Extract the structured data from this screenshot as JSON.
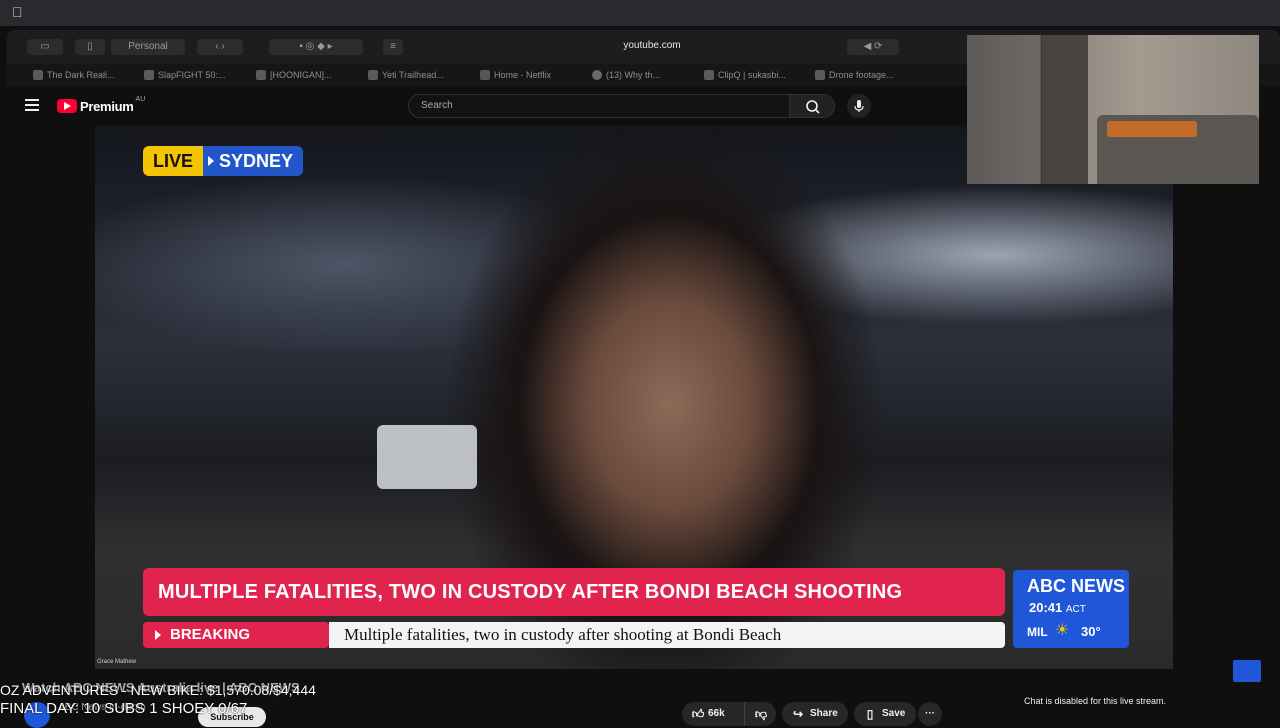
{
  "os": {
    "apple_icon": "apple-icon"
  },
  "browser": {
    "url": "youtube.com",
    "profile_label": "Personal",
    "tabs": [
      {
        "title": "The Dark Reali..."
      },
      {
        "title": "SlapFIGHT 50:..."
      },
      {
        "title": "[HOONIGAN]..."
      },
      {
        "title": "Yeti Trailhead..."
      },
      {
        "title": "Home - Netflix"
      },
      {
        "title": "(13) Why th..."
      },
      {
        "title": "ClipQ | sukasbi..."
      },
      {
        "title": "Drone footage..."
      }
    ]
  },
  "youtube": {
    "logo_text": "Premium",
    "region": "AU",
    "search_placeholder": "Search"
  },
  "video": {
    "live_word": "LIVE",
    "live_city": "SYDNEY",
    "headline": "MULTIPLE FATALITIES, TWO IN CUSTODY AFTER BONDI BEACH SHOOTING",
    "breaking_label": "BREAKING",
    "ticker": "Multiple fatalities, two in custody after shooting at Bondi Beach",
    "network": "ABC NEWS",
    "time": "20:41",
    "timezone": "ACT",
    "weather_location": "MIL",
    "temperature": "30°",
    "reporter": "Grace Mathew"
  },
  "overlay": {
    "line1": "OZ ADVENTURES - NEW BIKE: $1,570.08/$4,444",
    "line2": "FINAL DAY: 10 SUBS 1 SHOEY 0/67"
  },
  "below_video": {
    "title": "Watch ABC NEWS Australia live | ABC NEWS",
    "channel": "ABC News In-depth",
    "subscribe_label": "Subscribe",
    "like_count": "66k",
    "share_label": "Share",
    "save_label": "Save",
    "more_label": "···",
    "chat_disabled": "Chat is disabled for this live stream."
  },
  "colors": {
    "live_yellow": "#f5c400",
    "sydney_blue": "#2357c9",
    "headline_red": "#e0244e",
    "abc_blue": "#1f57d8",
    "youtube_red": "#ff0033"
  }
}
